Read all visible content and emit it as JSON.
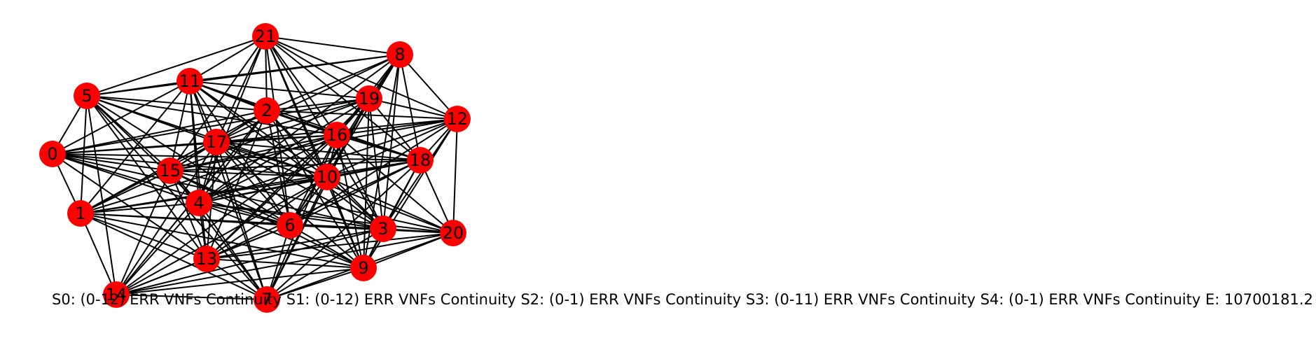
{
  "graph": {
    "node_color": "#ff0000",
    "edge_color": "#000000",
    "nodes": [
      "0",
      "1",
      "2",
      "3",
      "4",
      "5",
      "6",
      "7",
      "8",
      "9",
      "10",
      "11",
      "12",
      "13",
      "14",
      "15",
      "16",
      "17",
      "18",
      "19",
      "20",
      "21"
    ],
    "edges": [
      [
        "21",
        "5"
      ],
      [
        "21",
        "11"
      ],
      [
        "21",
        "8"
      ],
      [
        "21",
        "19"
      ],
      [
        "21",
        "12"
      ],
      [
        "21",
        "17"
      ],
      [
        "21",
        "2"
      ],
      [
        "21",
        "16"
      ],
      [
        "21",
        "10"
      ],
      [
        "21",
        "18"
      ],
      [
        "21",
        "4"
      ],
      [
        "21",
        "15"
      ],
      [
        "21",
        "6"
      ],
      [
        "21",
        "3"
      ],
      [
        "21",
        "9"
      ],
      [
        "8",
        "11"
      ],
      [
        "8",
        "5"
      ],
      [
        "8",
        "2"
      ],
      [
        "8",
        "17"
      ],
      [
        "8",
        "16"
      ],
      [
        "8",
        "19"
      ],
      [
        "8",
        "12"
      ],
      [
        "8",
        "18"
      ],
      [
        "8",
        "10"
      ],
      [
        "8",
        "4"
      ],
      [
        "8",
        "6"
      ],
      [
        "8",
        "3"
      ],
      [
        "8",
        "9"
      ],
      [
        "5",
        "11"
      ],
      [
        "5",
        "0"
      ],
      [
        "5",
        "1"
      ],
      [
        "5",
        "2"
      ],
      [
        "5",
        "17"
      ],
      [
        "5",
        "15"
      ],
      [
        "5",
        "4"
      ],
      [
        "5",
        "16"
      ],
      [
        "5",
        "10"
      ],
      [
        "5",
        "6"
      ],
      [
        "5",
        "13"
      ],
      [
        "5",
        "7"
      ],
      [
        "5",
        "14"
      ],
      [
        "11",
        "0"
      ],
      [
        "11",
        "2"
      ],
      [
        "11",
        "17"
      ],
      [
        "11",
        "15"
      ],
      [
        "11",
        "4"
      ],
      [
        "11",
        "16"
      ],
      [
        "11",
        "19"
      ],
      [
        "11",
        "18"
      ],
      [
        "11",
        "10"
      ],
      [
        "11",
        "6"
      ],
      [
        "11",
        "3"
      ],
      [
        "11",
        "13"
      ],
      [
        "11",
        "7"
      ],
      [
        "11",
        "1"
      ],
      [
        "2",
        "19"
      ],
      [
        "2",
        "12"
      ],
      [
        "2",
        "16"
      ],
      [
        "2",
        "17"
      ],
      [
        "2",
        "15"
      ],
      [
        "2",
        "0"
      ],
      [
        "2",
        "1"
      ],
      [
        "2",
        "4"
      ],
      [
        "2",
        "10"
      ],
      [
        "2",
        "18"
      ],
      [
        "2",
        "6"
      ],
      [
        "2",
        "3"
      ],
      [
        "2",
        "9"
      ],
      [
        "2",
        "13"
      ],
      [
        "2",
        "14"
      ],
      [
        "19",
        "12"
      ],
      [
        "19",
        "17"
      ],
      [
        "19",
        "16"
      ],
      [
        "19",
        "18"
      ],
      [
        "19",
        "10"
      ],
      [
        "19",
        "15"
      ],
      [
        "19",
        "4"
      ],
      [
        "19",
        "6"
      ],
      [
        "19",
        "3"
      ],
      [
        "19",
        "9"
      ],
      [
        "19",
        "13"
      ],
      [
        "19",
        "7"
      ],
      [
        "19",
        "0"
      ],
      [
        "12",
        "16"
      ],
      [
        "12",
        "17"
      ],
      [
        "12",
        "18"
      ],
      [
        "12",
        "10"
      ],
      [
        "12",
        "4"
      ],
      [
        "12",
        "6"
      ],
      [
        "12",
        "3"
      ],
      [
        "12",
        "20"
      ],
      [
        "12",
        "9"
      ],
      [
        "12",
        "15"
      ],
      [
        "16",
        "17"
      ],
      [
        "16",
        "0"
      ],
      [
        "16",
        "15"
      ],
      [
        "16",
        "4"
      ],
      [
        "16",
        "18"
      ],
      [
        "16",
        "10"
      ],
      [
        "16",
        "6"
      ],
      [
        "16",
        "3"
      ],
      [
        "16",
        "9"
      ],
      [
        "16",
        "13"
      ],
      [
        "16",
        "7"
      ],
      [
        "16",
        "20"
      ],
      [
        "16",
        "1"
      ],
      [
        "16",
        "14"
      ],
      [
        "17",
        "0"
      ],
      [
        "17",
        "15"
      ],
      [
        "17",
        "4"
      ],
      [
        "17",
        "1"
      ],
      [
        "17",
        "10"
      ],
      [
        "17",
        "18"
      ],
      [
        "17",
        "6"
      ],
      [
        "17",
        "13"
      ],
      [
        "17",
        "7"
      ],
      [
        "17",
        "3"
      ],
      [
        "17",
        "9"
      ],
      [
        "17",
        "20"
      ],
      [
        "17",
        "14"
      ],
      [
        "0",
        "15"
      ],
      [
        "0",
        "1"
      ],
      [
        "0",
        "4"
      ],
      [
        "0",
        "10"
      ],
      [
        "0",
        "6"
      ],
      [
        "0",
        "13"
      ],
      [
        "0",
        "18"
      ],
      [
        "0",
        "3"
      ],
      [
        "15",
        "4"
      ],
      [
        "15",
        "10"
      ],
      [
        "15",
        "18"
      ],
      [
        "15",
        "1"
      ],
      [
        "15",
        "6"
      ],
      [
        "15",
        "13"
      ],
      [
        "15",
        "14"
      ],
      [
        "15",
        "7"
      ],
      [
        "15",
        "20"
      ],
      [
        "15",
        "9"
      ],
      [
        "18",
        "10"
      ],
      [
        "18",
        "4"
      ],
      [
        "18",
        "6"
      ],
      [
        "18",
        "3"
      ],
      [
        "18",
        "20"
      ],
      [
        "18",
        "9"
      ],
      [
        "18",
        "13"
      ],
      [
        "18",
        "7"
      ],
      [
        "18",
        "1"
      ],
      [
        "10",
        "4"
      ],
      [
        "10",
        "1"
      ],
      [
        "10",
        "6"
      ],
      [
        "10",
        "3"
      ],
      [
        "10",
        "20"
      ],
      [
        "10",
        "9"
      ],
      [
        "10",
        "13"
      ],
      [
        "10",
        "7"
      ],
      [
        "10",
        "14"
      ],
      [
        "4",
        "1"
      ],
      [
        "4",
        "6"
      ],
      [
        "4",
        "3"
      ],
      [
        "4",
        "13"
      ],
      [
        "4",
        "7"
      ],
      [
        "4",
        "14"
      ],
      [
        "4",
        "9"
      ],
      [
        "4",
        "20"
      ],
      [
        "1",
        "6"
      ],
      [
        "1",
        "3"
      ],
      [
        "1",
        "13"
      ],
      [
        "1",
        "14"
      ],
      [
        "1",
        "7"
      ],
      [
        "1",
        "9"
      ],
      [
        "6",
        "3"
      ],
      [
        "6",
        "13"
      ],
      [
        "6",
        "7"
      ],
      [
        "6",
        "9"
      ],
      [
        "6",
        "20"
      ],
      [
        "6",
        "14"
      ],
      [
        "3",
        "20"
      ],
      [
        "3",
        "9"
      ],
      [
        "3",
        "13"
      ],
      [
        "3",
        "7"
      ],
      [
        "3",
        "14"
      ],
      [
        "20",
        "9"
      ],
      [
        "20",
        "13"
      ],
      [
        "20",
        "7"
      ],
      [
        "20",
        "14"
      ],
      [
        "9",
        "13"
      ],
      [
        "9",
        "7"
      ],
      [
        "9",
        "14"
      ],
      [
        "13",
        "7"
      ],
      [
        "13",
        "14"
      ],
      [
        "14",
        "7"
      ]
    ]
  },
  "caption": "S0: (0-12) ERR VNFs Continuity S1: (0-12) ERR VNFs Continuity S2: (0-1) ERR VNFs Continuity S3: (0-11) ERR VNFs Continuity S4: (0-1) ERR VNFs Continuity  E: 10700181.2"
}
